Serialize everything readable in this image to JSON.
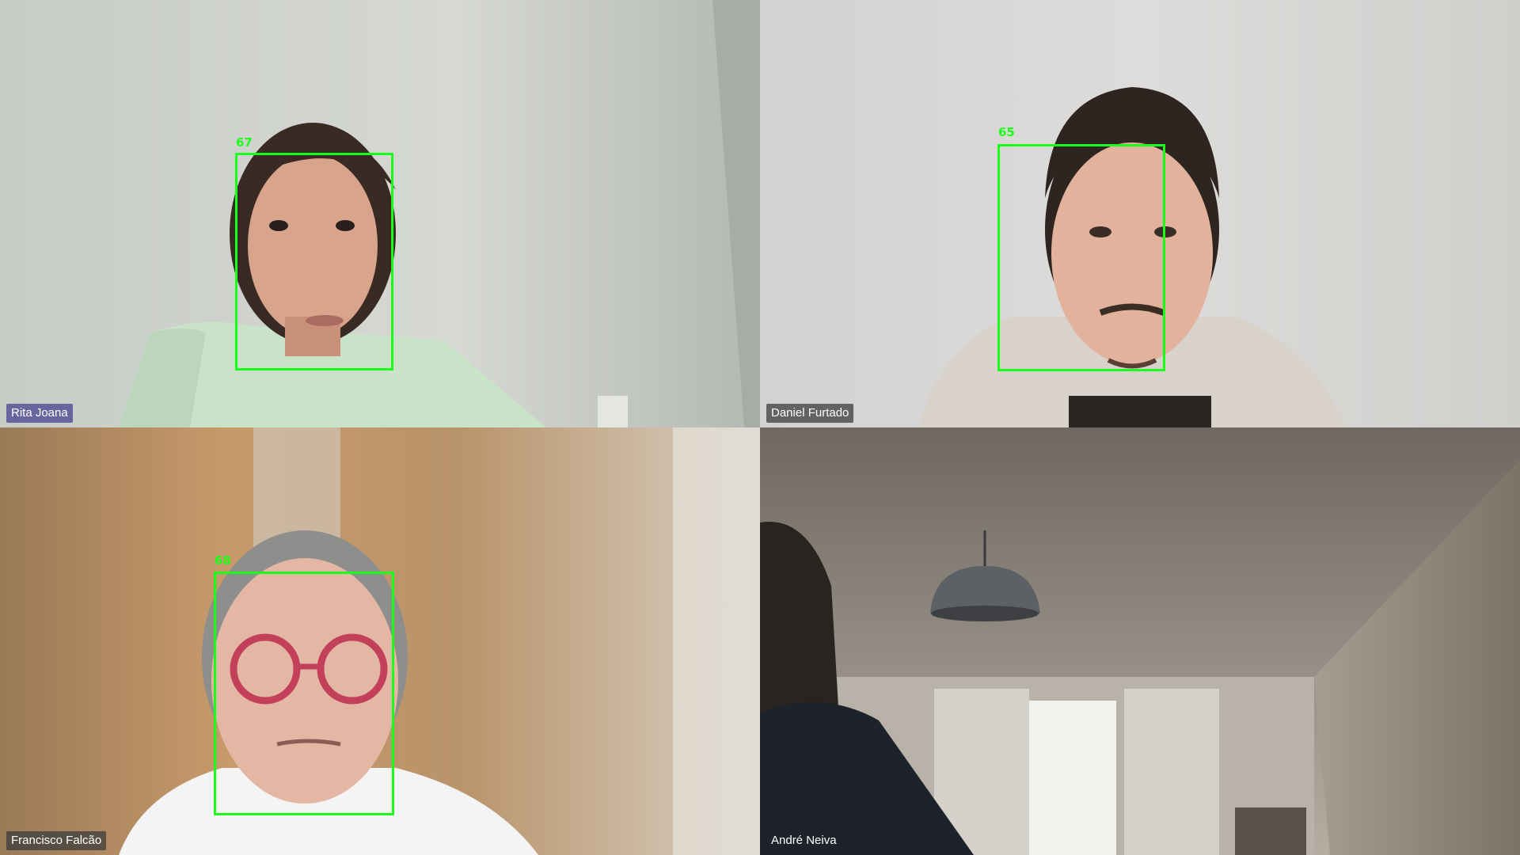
{
  "participants": [
    {
      "name": "Rita Joana",
      "face_score": "67"
    },
    {
      "name": "Daniel Furtado",
      "face_score": "65"
    },
    {
      "name": "Francisco Falcão",
      "face_score": "68"
    },
    {
      "name": "André Neiva"
    }
  ],
  "colors": {
    "detection_box": "#19ff19",
    "name_tag_active": "#5850a0",
    "name_tag_default": "#3c3c3c"
  }
}
